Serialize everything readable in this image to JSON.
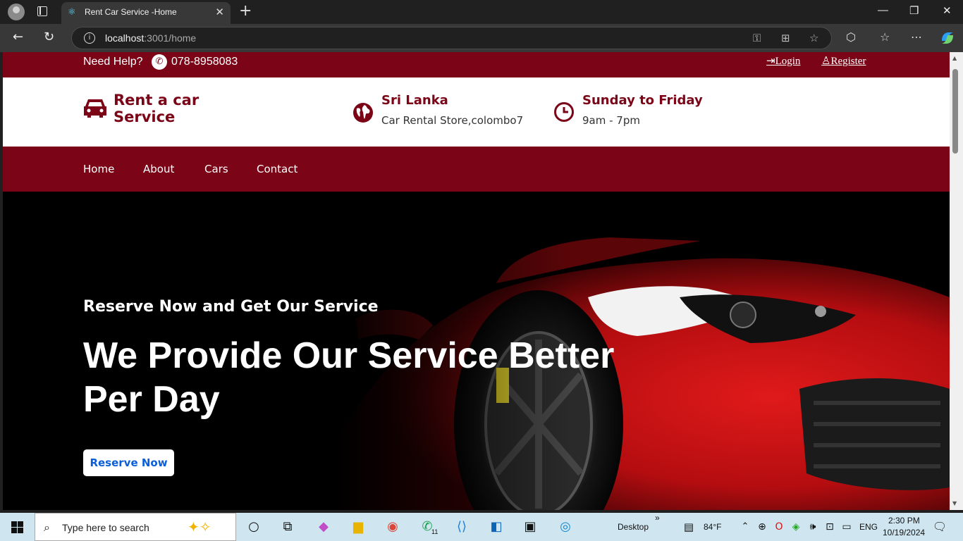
{
  "browser": {
    "tab_title": "Rent Car Service -Home",
    "url_host": "localhost",
    "url_path": ":3001/home"
  },
  "topbar": {
    "help_label": "Need Help?",
    "phone": "078-8958083",
    "login_label": "Login",
    "register_label": "Register"
  },
  "header": {
    "brand_line1": "Rent a car",
    "brand_line2": "Service",
    "location_title": "Sri Lanka",
    "location_sub": "Car Rental Store,colombo7",
    "hours_title": "Sunday to Friday",
    "hours_sub": "9am - 7pm"
  },
  "nav": {
    "items": [
      {
        "label": "Home"
      },
      {
        "label": "About"
      },
      {
        "label": "Cars"
      },
      {
        "label": "Contact"
      }
    ]
  },
  "hero": {
    "tagline": "Reserve Now and Get Our Service",
    "headline": "We Provide Our Service Better Per Day",
    "button_label": "Reserve Now"
  },
  "taskbar": {
    "search_placeholder": "Type here to search",
    "desktop_label": "Desktop",
    "weather": "84°F",
    "language": "ENG",
    "time": "2:30 PM",
    "date": "10/19/2024",
    "whatsapp_badge": "11"
  },
  "colors": {
    "brand_red": "#7b0517",
    "button_text": "#0b5ed7"
  }
}
